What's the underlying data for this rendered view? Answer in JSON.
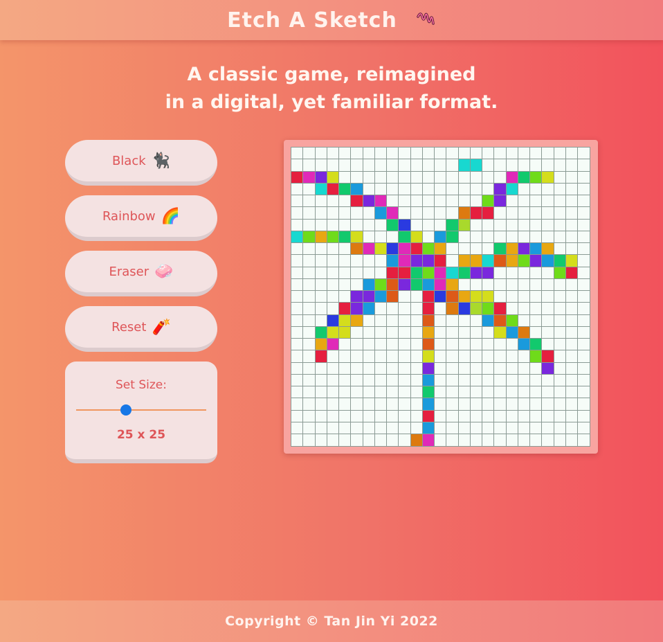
{
  "header": {
    "title": "Etch A Sketch",
    "icon": "squiggle-icon"
  },
  "tagline": {
    "line1": "A classic game, reimagined",
    "line2": "in a digital, yet familiar format."
  },
  "controls": {
    "black": {
      "label": "Black",
      "icon": "🐈‍⬛"
    },
    "rainbow": {
      "label": "Rainbow",
      "icon": "🌈"
    },
    "eraser": {
      "label": "Eraser",
      "icon": "🧼"
    },
    "reset": {
      "label": "Reset",
      "icon": "🧨"
    },
    "size": {
      "label": "Set Size:",
      "value_text": "25 x 25",
      "value": 25
    }
  },
  "board": {
    "columns": 25,
    "rows": 25,
    "background": "#f6fcf8",
    "line_color": "#8a9a94",
    "palette": [
      "#e51f3f",
      "#e02ab8",
      "#7a28dd",
      "#d4dd1c",
      "#18d8d0",
      "#12c96d",
      "#1a9adc",
      "#dd7a10",
      "#e8a712",
      "#a9d92c",
      "#6fdb1a",
      "#2a3ae0",
      "#dd5a18"
    ],
    "painted": [
      [
        1,
        14,
        4
      ],
      [
        1,
        15,
        4
      ],
      [
        2,
        0,
        0
      ],
      [
        2,
        1,
        1
      ],
      [
        2,
        2,
        2
      ],
      [
        2,
        3,
        3
      ],
      [
        2,
        18,
        1
      ],
      [
        2,
        19,
        5
      ],
      [
        2,
        20,
        10
      ],
      [
        2,
        21,
        3
      ],
      [
        3,
        2,
        4
      ],
      [
        3,
        3,
        0
      ],
      [
        3,
        4,
        5
      ],
      [
        3,
        5,
        6
      ],
      [
        3,
        17,
        2
      ],
      [
        3,
        18,
        4
      ],
      [
        4,
        5,
        0
      ],
      [
        4,
        6,
        2
      ],
      [
        4,
        7,
        1
      ],
      [
        4,
        16,
        10
      ],
      [
        4,
        17,
        2
      ],
      [
        5,
        7,
        6
      ],
      [
        5,
        8,
        1
      ],
      [
        5,
        14,
        7
      ],
      [
        5,
        15,
        0
      ],
      [
        5,
        16,
        0
      ],
      [
        6,
        8,
        5
      ],
      [
        6,
        9,
        11
      ],
      [
        6,
        13,
        5
      ],
      [
        6,
        14,
        9
      ],
      [
        7,
        0,
        4
      ],
      [
        7,
        1,
        10
      ],
      [
        7,
        2,
        8
      ],
      [
        7,
        3,
        10
      ],
      [
        7,
        4,
        5
      ],
      [
        7,
        5,
        3
      ],
      [
        7,
        9,
        5
      ],
      [
        7,
        10,
        3
      ],
      [
        7,
        12,
        6
      ],
      [
        7,
        13,
        5
      ],
      [
        8,
        5,
        7
      ],
      [
        8,
        6,
        1
      ],
      [
        8,
        7,
        3
      ],
      [
        8,
        8,
        11
      ],
      [
        8,
        9,
        1
      ],
      [
        8,
        10,
        0
      ],
      [
        8,
        11,
        10
      ],
      [
        8,
        12,
        8
      ],
      [
        8,
        17,
        5
      ],
      [
        8,
        18,
        8
      ],
      [
        8,
        19,
        2
      ],
      [
        8,
        20,
        6
      ],
      [
        8,
        21,
        8
      ],
      [
        9,
        8,
        6
      ],
      [
        9,
        9,
        1
      ],
      [
        9,
        10,
        2
      ],
      [
        9,
        11,
        2
      ],
      [
        9,
        12,
        0
      ],
      [
        9,
        14,
        8
      ],
      [
        9,
        15,
        8
      ],
      [
        9,
        16,
        4
      ],
      [
        9,
        17,
        12
      ],
      [
        9,
        18,
        8
      ],
      [
        9,
        19,
        10
      ],
      [
        9,
        20,
        2
      ],
      [
        9,
        21,
        6
      ],
      [
        9,
        22,
        5
      ],
      [
        9,
        23,
        3
      ],
      [
        10,
        8,
        0
      ],
      [
        10,
        9,
        0
      ],
      [
        10,
        10,
        5
      ],
      [
        10,
        11,
        10
      ],
      [
        10,
        12,
        1
      ],
      [
        10,
        13,
        4
      ],
      [
        10,
        14,
        5
      ],
      [
        10,
        15,
        2
      ],
      [
        10,
        16,
        2
      ],
      [
        10,
        22,
        10
      ],
      [
        10,
        23,
        0
      ],
      [
        11,
        6,
        6
      ],
      [
        11,
        7,
        10
      ],
      [
        11,
        8,
        12
      ],
      [
        11,
        9,
        2
      ],
      [
        11,
        10,
        5
      ],
      [
        11,
        11,
        6
      ],
      [
        11,
        12,
        1
      ],
      [
        11,
        13,
        8
      ],
      [
        12,
        5,
        2
      ],
      [
        12,
        6,
        2
      ],
      [
        12,
        7,
        6
      ],
      [
        12,
        8,
        12
      ],
      [
        12,
        11,
        0
      ],
      [
        12,
        12,
        11
      ],
      [
        12,
        13,
        12
      ],
      [
        12,
        14,
        8
      ],
      [
        12,
        15,
        3
      ],
      [
        12,
        16,
        3
      ],
      [
        13,
        4,
        0
      ],
      [
        13,
        5,
        2
      ],
      [
        13,
        6,
        6
      ],
      [
        13,
        11,
        0
      ],
      [
        13,
        13,
        7
      ],
      [
        13,
        14,
        11
      ],
      [
        13,
        15,
        9
      ],
      [
        13,
        16,
        10
      ],
      [
        13,
        17,
        0
      ],
      [
        14,
        3,
        11
      ],
      [
        14,
        4,
        3
      ],
      [
        14,
        5,
        8
      ],
      [
        14,
        11,
        12
      ],
      [
        14,
        16,
        6
      ],
      [
        14,
        17,
        12
      ],
      [
        14,
        18,
        10
      ],
      [
        15,
        2,
        5
      ],
      [
        15,
        3,
        3
      ],
      [
        15,
        4,
        3
      ],
      [
        15,
        11,
        8
      ],
      [
        15,
        17,
        3
      ],
      [
        15,
        18,
        6
      ],
      [
        15,
        19,
        7
      ],
      [
        16,
        2,
        8
      ],
      [
        16,
        3,
        1
      ],
      [
        16,
        11,
        12
      ],
      [
        16,
        19,
        6
      ],
      [
        16,
        20,
        5
      ],
      [
        17,
        2,
        0
      ],
      [
        17,
        11,
        3
      ],
      [
        17,
        20,
        10
      ],
      [
        17,
        21,
        0
      ],
      [
        18,
        11,
        2
      ],
      [
        18,
        21,
        2
      ],
      [
        19,
        11,
        6
      ],
      [
        20,
        11,
        5
      ],
      [
        21,
        11,
        6
      ],
      [
        22,
        11,
        0
      ],
      [
        23,
        11,
        6
      ],
      [
        24,
        10,
        7
      ],
      [
        24,
        11,
        1
      ]
    ]
  },
  "footer": {
    "text": "Copyright © Tan Jin Yi 2022"
  }
}
